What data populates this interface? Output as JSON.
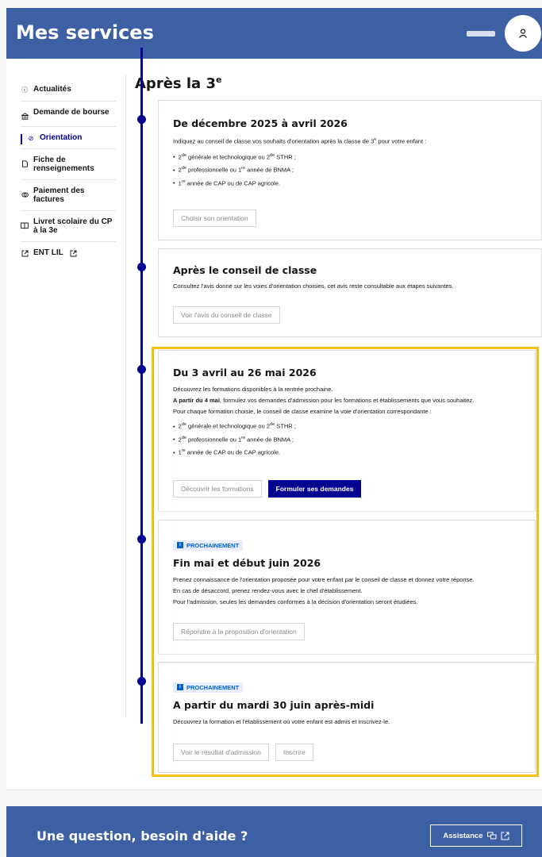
{
  "header": {
    "title": "Mes services",
    "user_icon": "user-icon"
  },
  "sidebar": {
    "items": [
      {
        "label": "Actualités",
        "icon": "info-icon"
      },
      {
        "label": "Demande de bourse",
        "icon": "bank-icon"
      },
      {
        "label": "Orientation",
        "icon": "compass-icon",
        "active": true
      },
      {
        "label": "Fiche de renseignements",
        "icon": "file-icon"
      },
      {
        "label": "Paiement des factures",
        "icon": "coins-icon"
      },
      {
        "label": "Livret scolaire du CP à la 3e",
        "icon": "book-icon"
      },
      {
        "label": "ENT LIL",
        "icon": "external-link-icon"
      }
    ]
  },
  "page": {
    "title": "Après la 3",
    "title_sup": "e"
  },
  "cards": {
    "c1": {
      "title": "De décembre 2025 à avril 2026",
      "intro_a": "Indiquez au conseil de classe vos souhaits d'orientation après la classe de 3",
      "intro_sup": "e",
      "intro_b": " pour votre enfant :",
      "li1_a": "2",
      "li1_s1": "de",
      "li1_b": " générale et technologique ou 2",
      "li1_s2": "de",
      "li1_c": " STHR ;",
      "li2_a": "2",
      "li2_s1": "de",
      "li2_b": " professionnelle ou 1",
      "li2_s2": "re",
      "li2_c": " année de BNMA ;",
      "li3_a": "1",
      "li3_s1": "re",
      "li3_b": " année de CAP ou de CAP agricole.",
      "button": "Choisir son orientation"
    },
    "c2": {
      "title": "Après le conseil de classe",
      "text": "Consultez l'avis donné sur les voies d'orientation choisies, cet avis reste consultable aux étapes suivantes.",
      "button": "Voir l'avis du conseil de classe"
    },
    "c3": {
      "title": "Du 3 avril au 26 mai 2026",
      "p1": "Découvrez les formations disponibles à la rentrée prochaine.",
      "p2_bold": "A partir du 4 mai",
      "p2_rest": ", formulez vos demandes d'admission pour les formations et établissements que vous souhaitez.",
      "p3": "Pour chaque formation choisie, le conseil de classe examine la voie d'orientation correspondante :",
      "li1_a": "2",
      "li1_s1": "de",
      "li1_b": " générale et technologique ou 2",
      "li1_s2": "de",
      "li1_c": " STHR ;",
      "li2_a": "2",
      "li2_s1": "de",
      "li2_b": " professionnelle ou 1",
      "li2_s2": "re",
      "li2_c": " année de BNMA ;",
      "li3_a": "1",
      "li3_s1": "re",
      "li3_b": " année de CAP ou de CAP agricole.",
      "button1": "Découvrir les formations",
      "button2": "Formuler ses demandes"
    },
    "c4": {
      "badge": "PROCHAINEMENT",
      "title": "Fin mai et début juin 2026",
      "p1": "Prenez connaissance de l'orientation proposée pour votre enfant par le conseil de classe et donnez votre réponse.",
      "p2": "En cas de désaccord, prenez rendez-vous avec le chef d'établissement.",
      "p3": "Pour l'admission, seules les demandes conformes à la décision d'orientation seront étudiées.",
      "button": "Répondre à la proposition d'orientation"
    },
    "c5": {
      "badge": "PROCHAINEMENT",
      "title": "A partir du mardi 30 juin après-midi",
      "text": "Découvrez la formation et l'établissement où votre enfant est admis et inscrivez-le.",
      "button1": "Voir le résultat d'admission",
      "button2": "Inscrire"
    }
  },
  "footer": {
    "title": "Une question, besoin d'aide ?",
    "assist_label": "Assistance"
  },
  "colors": {
    "header_bg": "#3d5fa3",
    "primary": "#000091",
    "highlight": "#f5c013",
    "badge_text": "#0063cb",
    "badge_bg": "#e8edff"
  }
}
